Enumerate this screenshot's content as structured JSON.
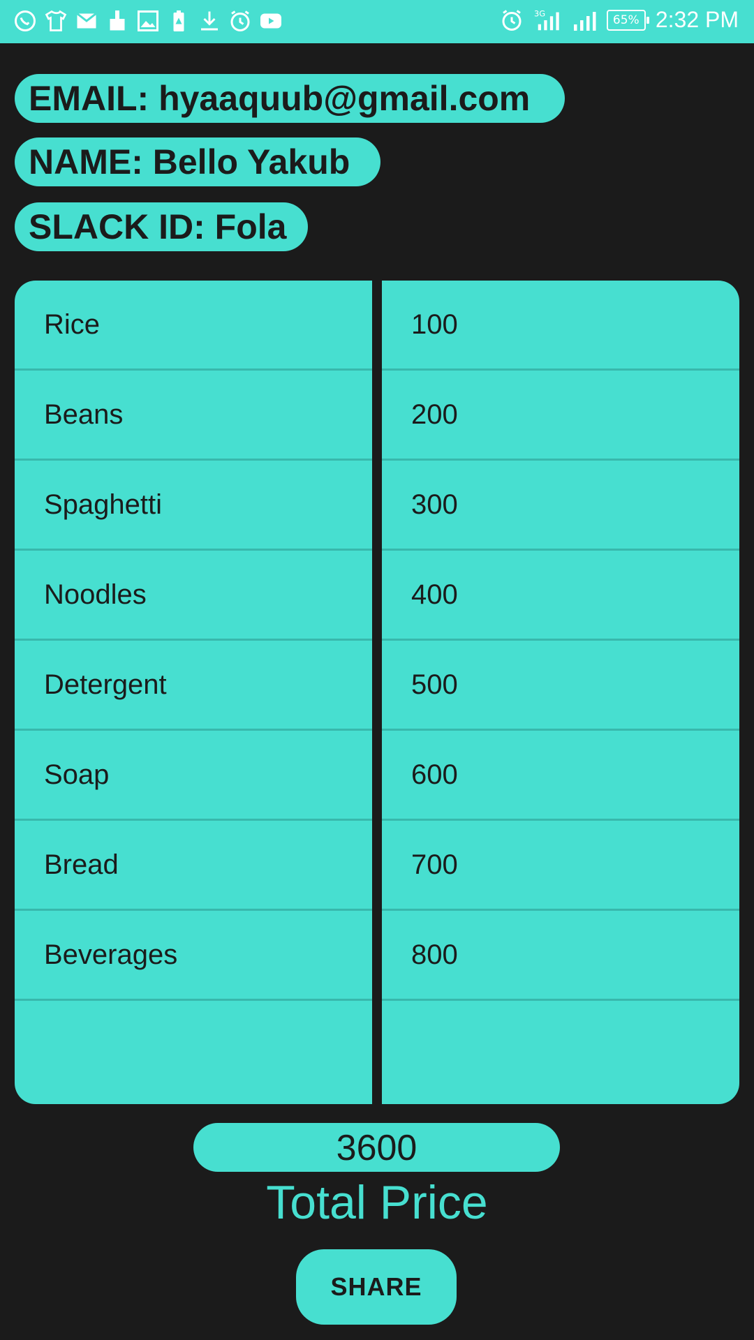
{
  "status_bar": {
    "time": "2:32 PM",
    "battery": "65%",
    "network": "3G",
    "left_icons": [
      "whatsapp-icon",
      "tshirt-icon",
      "gmail-icon",
      "brush-icon",
      "gallery-icon",
      "battery-saver-icon",
      "download-icon",
      "alarm-icon",
      "youtube-icon"
    ],
    "right_icons": [
      "alarm-icon",
      "signal-icon",
      "signal-icon",
      "battery-icon"
    ]
  },
  "profile": {
    "email": "EMAIL: hyaaquub@gmail.com",
    "name": "NAME: Bello Yakub",
    "slack": "SLACK ID: Fola"
  },
  "items": [
    {
      "name": "Rice",
      "price": "100"
    },
    {
      "name": "Beans",
      "price": "200"
    },
    {
      "name": "Spaghetti",
      "price": "300"
    },
    {
      "name": "Noodles",
      "price": "400"
    },
    {
      "name": "Detergent",
      "price": "500"
    },
    {
      "name": "Soap",
      "price": "600"
    },
    {
      "name": "Bread",
      "price": "700"
    },
    {
      "name": "Beverages",
      "price": "800"
    }
  ],
  "total": {
    "value": "3600",
    "label": "Total Price"
  },
  "share_label": "SHARE",
  "colors": {
    "accent": "#47dfd0",
    "background": "#1b1b1b",
    "text_dark": "#1b1b1b"
  }
}
